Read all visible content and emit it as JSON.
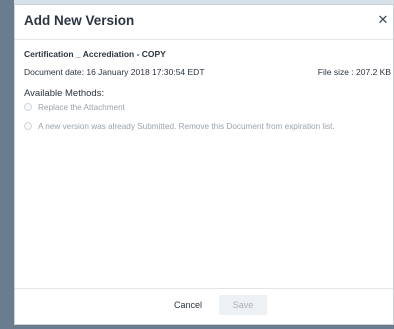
{
  "dialog": {
    "title": "Add New Version",
    "close_icon": "close-icon"
  },
  "document": {
    "name": "Certification _ Accrediation - COPY",
    "date": "Document date: 16 January 2018 17:30:54 EDT",
    "file_size": "File size : 207.2 KB"
  },
  "methods": {
    "label": "Available Methods:",
    "options": [
      {
        "label": "Replace the Attachment",
        "selected": false,
        "disabled": true
      },
      {
        "label": "A new version was already Submitted. Remove this Document from expiration list.",
        "selected": false,
        "disabled": true
      }
    ]
  },
  "footer": {
    "cancel_label": "Cancel",
    "save_label": "Save"
  },
  "colors": {
    "title_text": "#2b3540",
    "disabled_text": "#9aa3ab",
    "save_disabled_bg": "#eef1f4",
    "backdrop": "#6a7d8f"
  }
}
